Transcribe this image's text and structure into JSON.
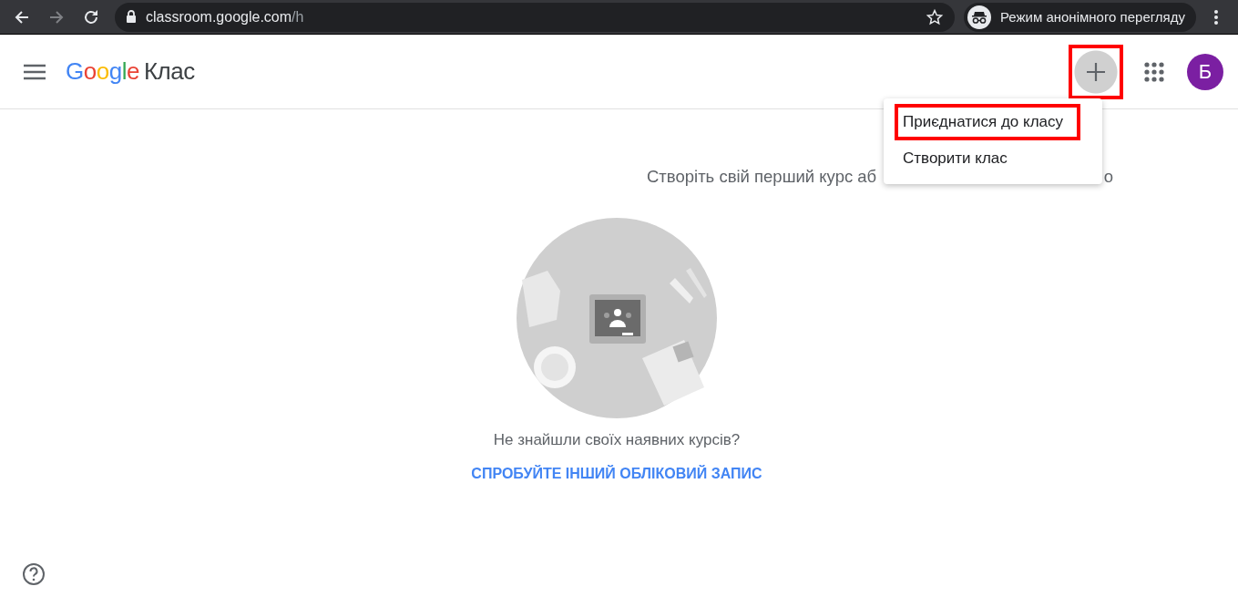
{
  "browser": {
    "url_host": "classroom.google.com",
    "url_path": "/h",
    "incognito_label": "Режим анонімного перегляду"
  },
  "app_bar": {
    "logo_brand": "Google",
    "logo_product": "Клас",
    "add_button": {
      "highlighted": true
    },
    "avatar": "Б"
  },
  "menu": {
    "items": [
      {
        "label": "Приєднатися до класу",
        "highlighted": true
      },
      {
        "label": "Створити клас",
        "highlighted": false
      }
    ]
  },
  "subtitle": {
    "visible_start": "Створіть свій перший курс аб",
    "visible_end": "о"
  },
  "prompt": "Не знайшли своїх наявних курсів?",
  "link": "СПРОБУЙТЕ ІНШИЙ ОБЛІКОВИЙ ЗАПИС"
}
